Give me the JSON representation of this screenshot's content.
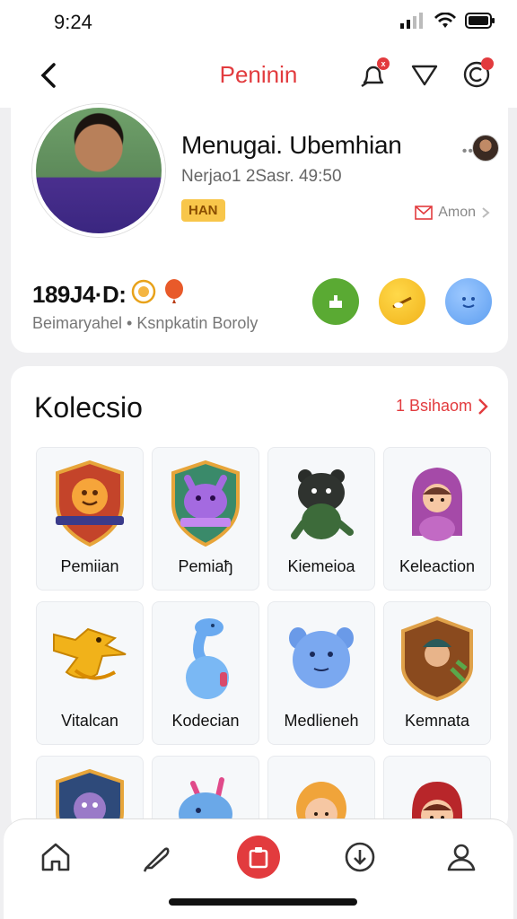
{
  "status_bar": {
    "time": "9:24"
  },
  "header": {
    "title": "Peninin",
    "notification_count": "x"
  },
  "profile": {
    "name": "Menugai. Ubemhian",
    "subline": "Nerjao1 2Sasr. 49:50",
    "badge": "HAN",
    "more": "••",
    "action_link": "Amon",
    "stats_value": "189J4·D:",
    "stats_sub": "Beimaryahel • Ksnpkatin Boroly"
  },
  "collection": {
    "title": "Kolecsio",
    "see_all": "1 Bsihaom",
    "items": [
      {
        "label": "Pemiian",
        "art": "shield-sun"
      },
      {
        "label": "Pemiaђ",
        "art": "shield-creature"
      },
      {
        "label": "Kiemeioa",
        "art": "dark-bear"
      },
      {
        "label": "Keleaction",
        "art": "girl-hood"
      },
      {
        "label": "Vitalcan",
        "art": "yellow-dragon"
      },
      {
        "label": "Kodeсian",
        "art": "blue-seal"
      },
      {
        "label": "Medlieneh",
        "art": "blue-hippo"
      },
      {
        "label": "Kemnata",
        "art": "framed-hero"
      },
      {
        "label": "",
        "art": "shield-face"
      },
      {
        "label": "",
        "art": "blue-creature"
      },
      {
        "label": "",
        "art": "blonde-girl"
      },
      {
        "label": "",
        "art": "redhead-girl"
      }
    ]
  },
  "colors": {
    "accent": "#e23b3e",
    "badge": "#f8c64a"
  }
}
